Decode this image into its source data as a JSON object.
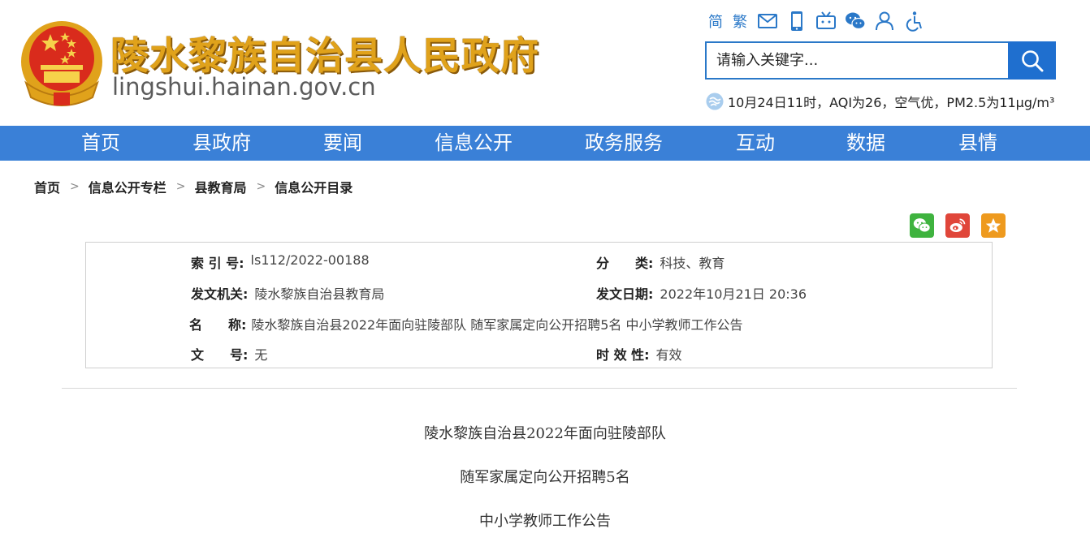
{
  "header": {
    "site_title": "陵水黎族自治县人民政府",
    "site_domain": "lingshui.hainan.gov.cn",
    "toolbar": {
      "simplified": "简",
      "traditional": "繁"
    },
    "search": {
      "placeholder": "请输入关键字..."
    },
    "weather": "10月24日11时，AQI为26，空气优，PM2.5为11μg/m³"
  },
  "nav": {
    "items": [
      "首页",
      "县政府",
      "要闻",
      "信息公开",
      "政务服务",
      "互动",
      "数据",
      "县情"
    ]
  },
  "breadcrumb": [
    "首页",
    "信息公开专栏",
    "县教育局",
    "信息公开目录"
  ],
  "breadcrumb_sep": ">",
  "info": {
    "index_label": "索 引 号:",
    "index_value": "ls112/2022-00188",
    "category_label": "分　　类:",
    "category_value": "科技、教育",
    "issuer_label": "发文机关:",
    "issuer_value": "陵水黎族自治县教育局",
    "date_label": "发文日期:",
    "date_value": "2022年10月21日 20:36",
    "name_label": "名　　称:",
    "name_value": "陵水黎族自治县2022年面向驻陵部队 随军家属定向公开招聘5名 中小学教师工作公告",
    "docno_label": "文　　号:",
    "docno_value": "无",
    "validity_label": "时 效 性:",
    "validity_value": "有效"
  },
  "article": {
    "lines": [
      "陵水黎族自治县2022年面向驻陵部队",
      "随军家属定向公开招聘5名",
      "中小学教师工作公告"
    ]
  },
  "colors": {
    "nav_bg": "#3a80d7",
    "accent": "#1f6fcf",
    "title_gold": "#e0a21b"
  }
}
